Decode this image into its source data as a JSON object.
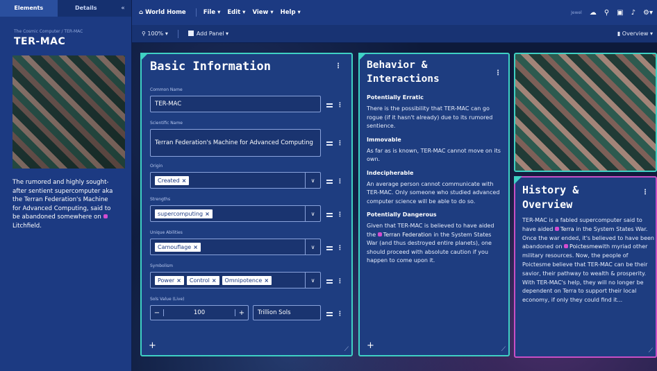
{
  "sidebar": {
    "tabs": [
      "Elements",
      "Details"
    ],
    "collapse_icon": "chevron-double-left-icon",
    "breadcrumb": "The Cosmic Computer / TER-MAC",
    "title": "TER-MAC",
    "description_pre": "The rumored and highly sought-after sentient supercomputer aka the Terran Federation's Machine for Advanced Computing, said to be abandoned somewhere on ",
    "description_link": "Litchfield",
    "description_post": "."
  },
  "topbar": {
    "home": "World Home",
    "menus": [
      "File",
      "Edit",
      "View",
      "Help"
    ],
    "user": "Jewel",
    "icons": [
      "cloud-icon",
      "search-icon",
      "layout-icon",
      "bell-icon",
      "gear-icon"
    ]
  },
  "subbar": {
    "zoom": "100%",
    "add_panel": "Add Panel",
    "overview": "Overview"
  },
  "basic_panel": {
    "title": "Basic Information",
    "fields": {
      "common_name_label": "Common Name",
      "common_name_value": "TER-MAC",
      "scientific_name_label": "Scientific Name",
      "scientific_name_value": "Terran Federation's Machine for Advanced Computing",
      "origin_label": "Origin",
      "origin_chips": [
        "Created"
      ],
      "strengths_label": "Strengths",
      "strengths_chips": [
        "supercomputing"
      ],
      "abilities_label": "Unique Abilities",
      "abilities_chips": [
        "Camouflage"
      ],
      "symbolism_label": "Symbolism",
      "symbolism_chips": [
        "Power",
        "Control",
        "Omnipotence"
      ],
      "value_label": "Sols Value (Live)",
      "value_number": "100",
      "value_unit": "Trillion Sols"
    }
  },
  "behavior_panel": {
    "title_line1": "Behavior &",
    "title_line2": "Interactions",
    "sections": [
      {
        "heading": "Potentially Erratic",
        "text": "There is the possibility that TER-MAC can go rogue (if it hasn't already) due to its rumored sentience."
      },
      {
        "heading": "Immovable",
        "text": "As far as is known, TER-MAC cannot move on its own."
      },
      {
        "heading": "Indecipherable",
        "text": "An average person cannot communicate with TER-MAC. Only someone who studied advanced computer science will be able to do so."
      },
      {
        "heading": "Potentially Dangerous",
        "text_pre": "Given that TER-MAC is believed to have aided the ",
        "link": "Terran Federation",
        "text_post": " in the System States War (and thus destroyed entire planets), one should proceed with absolute caution if you happen to come upon it."
      }
    ]
  },
  "history_panel": {
    "title_line1": "History &",
    "title_line2": "Overview",
    "text_a": "TER-MAC is a fabled supercomputer said to have aided ",
    "link_a": "Terra",
    "text_b": " in the System States War. Once the war ended, it's believed to have been abandoned on ",
    "link_b": "Poictesme",
    "text_c": "with myriad other military resources. Now, the people of Poictesme believe that TER-MAC can be their savior, their pathway to wealth & prosperity. With TER-MAC's help, they will no longer be dependent on Terra to support their local economy, if only they could find it..."
  },
  "colors": {
    "accent_teal": "#3fd1c4",
    "accent_magenta": "#c84fc5",
    "panel_blue": "#1e3d80",
    "bar_blue": "#1c3a82"
  }
}
